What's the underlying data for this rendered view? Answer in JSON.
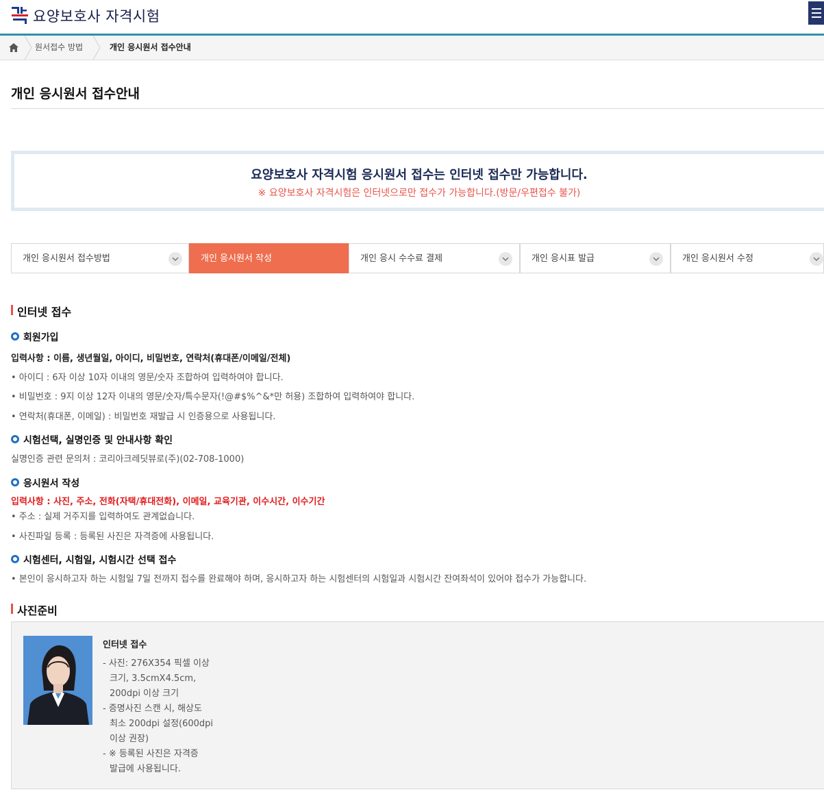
{
  "header": {
    "logo_text": "요양보호사 자격시험",
    "menu_icon": "hamburger-menu-icon"
  },
  "breadcrumb": {
    "home_icon": "home-icon",
    "items": [
      "원서접수 방법",
      "개인 응시원서 접수안내"
    ]
  },
  "page": {
    "title": "개인 응시원서 접수안내"
  },
  "notice": {
    "main": "요양보호사 자격시험 응시원서 접수는 인터넷 접수만 가능합니다.",
    "sub": "※ 요양보호사 자격시험은 인터넷으로만 접수가 가능합니다.(방문/우편접수 불가)"
  },
  "tabs": [
    {
      "label": "개인 응시원서 접수방법",
      "active": false
    },
    {
      "label": "개인 응시원서 작성",
      "active": true
    },
    {
      "label": "개인 응시 수수료 결제",
      "active": false
    },
    {
      "label": "개인 응시표 발급",
      "active": false
    },
    {
      "label": "개인 응시원서 수정",
      "active": false
    }
  ],
  "internet": {
    "title": "인터넷 접수",
    "signup": {
      "title": "회원가입",
      "input_items": "입력사항 : 이름, 생년월일, 아이디, 비밀번호, 연락처(휴대폰/이메일/전체)",
      "bullets": [
        "• 아이디 : 6자 이상 10자 이내의 영문/숫자 조합하여 입력하여야 합니다.",
        "• 비밀번호 : 9지 이상 12자 이내의 영문/숫자/특수문자(!@#$%^&*만 허용) 조합하여 입력하여야 합니다.",
        "• 연락처(휴대폰, 이메일) : 비밀번호 재발급 시 인증용으로 사용됩니다."
      ]
    },
    "verify": {
      "title": "시험선택, 실명인증 및 안내사항 확인",
      "text": "실명인증 관련 문의처 : 코리아크레딧뷰로(주)(02-708-1000)"
    },
    "application": {
      "title": "응시원서 작성",
      "input_items": "입력사항 : 사진, 주소, 전화(자택/휴대전화), 이메일, 교육기관, 이수시간, 이수기간",
      "bullets": [
        "• 주소 : 실제 거주지를 입력하여도 관계없습니다.",
        "• 사진파일 등록 : 등록된 사진은 자격증에 사용됩니다."
      ]
    },
    "center": {
      "title": "시험센터, 시험일, 시험시간 선택 접수",
      "text": "• 본인이 응시하고자 하는 시험일 7일 전까지 접수를 완료해야 하며, 응시하고자 하는 시험센터의 시험일과 시험시간 잔여좌석이 있어야 접수가 가능합니다."
    }
  },
  "photo_section": {
    "title": "사진준비",
    "box_title": "인터넷 접수",
    "lines": [
      "- 사진: 276X354 픽셀 이상",
      "  크기, 3.5cmX4.5cm,",
      "  200dpi 이상 크기",
      "- 증명사진 스캔 시, 해상도",
      "  최소 200dpi 설정(600dpi",
      "  이상 권장)",
      "- ※ 등록된 사진은 자격증",
      "  발급에 사용됩니다."
    ]
  },
  "colors": {
    "accent": "#ee6e4f",
    "notice_red": "#e8534a",
    "header_rule": "#2f8fa8",
    "ring_blue": "#1f6fc5"
  }
}
